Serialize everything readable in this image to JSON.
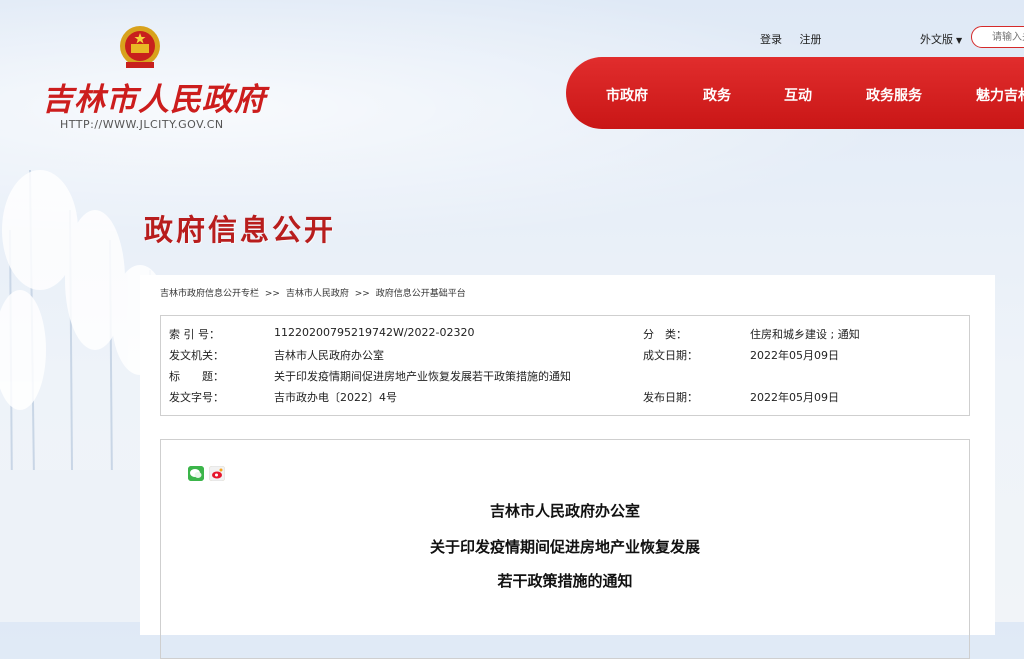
{
  "header": {
    "logo_text": "吉林市人民政府",
    "logo_url": "HTTP://WWW.JLCITY.GOV.CN",
    "top_links": [
      "登录",
      "注册"
    ],
    "language": "外文版",
    "search_placeholder": "请输入关"
  },
  "nav": {
    "items": [
      "市政府",
      "政务",
      "互动",
      "政务服务",
      "魅力吉林"
    ]
  },
  "section_title": "政府信息公开",
  "breadcrumb": [
    "吉林市政府信息公开专栏",
    "吉林市人民政府",
    "政府信息公开基础平台"
  ],
  "breadcrumb_sep": ">>",
  "meta": {
    "index_label": "索 引 号：",
    "index_value": "11220200795219742W/2022-02320",
    "category_label": "分　类：",
    "category_value": "住房和城乡建设 ; 通知",
    "issuer_label": "发文机关：",
    "issuer_value": "吉林市人民政府办公室",
    "created_label": "成文日期：",
    "created_value": "2022年05月09日",
    "title_label": "标　　题：",
    "title_value": "关于印发疫情期间促进房地产业恢复发展若干政策措施的通知",
    "docno_label": "发文字号：",
    "docno_value": "吉市政办电〔2022〕4号",
    "published_label": "发布日期：",
    "published_value": "2022年05月09日"
  },
  "document": {
    "title_lines": [
      "吉林市人民政府办公室",
      "关于印发疫情期间促进房地产业恢复发展",
      "若干政策措施的通知"
    ]
  },
  "colors": {
    "brand_red": "#cc1d1d",
    "nav_red": "#d52121"
  }
}
